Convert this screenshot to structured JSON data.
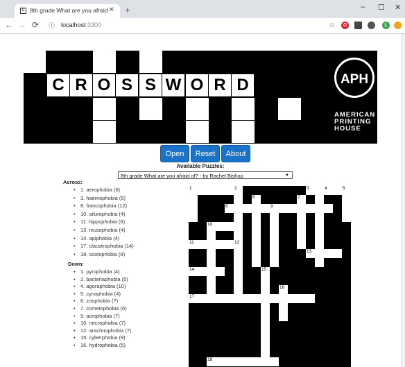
{
  "browser": {
    "tab_title": "8th grade What are you afraid of",
    "url_host": "localhost",
    "url_port": ":3300"
  },
  "banner": {
    "word": [
      "C",
      "R",
      "O",
      "S",
      "S",
      "W",
      "O",
      "R",
      "D"
    ],
    "org_lines": [
      "AMERICAN",
      "PRINTING",
      "HOUSE"
    ],
    "logo_text": "APH"
  },
  "buttons": {
    "open": "Open",
    "reset": "Reset",
    "about": "About"
  },
  "puzzles": {
    "label": "Available Puzzles:",
    "selected": "8th grade What are you afraid of? - by Rachel Bishop"
  },
  "across": {
    "heading": "Across:",
    "clues": [
      "1. aerophobia (6)",
      "3. haemophobia (5)",
      "8. francophobia (12)",
      "10. ailurophobia (4)",
      "11. hippophobia (6)",
      "13. musophobia (4)",
      "14. apiphobia (4)",
      "17. claustrophobia (14)",
      "18. scotophobia (8)"
    ]
  },
  "down": {
    "heading": "Down:",
    "clues": [
      "1. pyrophobia (4)",
      "2. bacteriaphobia (5)",
      "4. agoraphobia (10)",
      "5. cynophobia (4)",
      "6. zoophobia (7)",
      "7. cometophobia (6)",
      "9. acrophobia (7)",
      "10. necrophobia (7)",
      "12. arachnophobia (7)",
      "15. cyberphobia (9)",
      "16. hydrophobia (5)"
    ]
  },
  "grid": {
    "columns": 18,
    "rows": 20,
    "white_cells": [
      [
        0,
        0
      ],
      [
        1,
        0
      ],
      [
        2,
        0
      ],
      [
        3,
        0
      ],
      [
        4,
        0
      ],
      [
        5,
        0
      ],
      [
        13,
        0
      ],
      [
        14,
        0
      ],
      [
        15,
        0
      ],
      [
        16,
        0
      ],
      [
        17,
        0
      ],
      [
        0,
        1
      ],
      [
        5,
        1
      ],
      [
        7,
        1
      ],
      [
        12,
        1
      ],
      [
        14,
        1
      ],
      [
        17,
        1
      ],
      [
        0,
        2
      ],
      [
        4,
        2
      ],
      [
        5,
        2
      ],
      [
        6,
        2
      ],
      [
        7,
        2
      ],
      [
        8,
        2
      ],
      [
        9,
        2
      ],
      [
        10,
        2
      ],
      [
        11,
        2
      ],
      [
        12,
        2
      ],
      [
        13,
        2
      ],
      [
        14,
        2
      ],
      [
        15,
        2
      ],
      [
        17,
        2
      ],
      [
        0,
        3
      ],
      [
        5,
        3
      ],
      [
        7,
        3
      ],
      [
        9,
        3
      ],
      [
        12,
        3
      ],
      [
        14,
        3
      ],
      [
        17,
        3
      ],
      [
        2,
        4
      ],
      [
        3,
        4
      ],
      [
        4,
        4
      ],
      [
        5,
        4
      ],
      [
        7,
        4
      ],
      [
        9,
        4
      ],
      [
        12,
        4
      ],
      [
        14,
        4
      ],
      [
        2,
        5
      ],
      [
        5,
        5
      ],
      [
        7,
        5
      ],
      [
        9,
        5
      ],
      [
        12,
        5
      ],
      [
        14,
        5
      ],
      [
        0,
        6
      ],
      [
        1,
        6
      ],
      [
        2,
        6
      ],
      [
        3,
        6
      ],
      [
        4,
        6
      ],
      [
        5,
        6
      ],
      [
        7,
        6
      ],
      [
        9,
        6
      ],
      [
        12,
        6
      ],
      [
        14,
        6
      ],
      [
        2,
        7
      ],
      [
        5,
        7
      ],
      [
        7,
        7
      ],
      [
        9,
        7
      ],
      [
        13,
        7
      ],
      [
        14,
        7
      ],
      [
        15,
        7
      ],
      [
        16,
        7
      ],
      [
        2,
        8
      ],
      [
        5,
        8
      ],
      [
        7,
        8
      ],
      [
        9,
        8
      ],
      [
        14,
        8
      ],
      [
        0,
        9
      ],
      [
        1,
        9
      ],
      [
        2,
        9
      ],
      [
        3,
        9
      ],
      [
        5,
        9
      ],
      [
        8,
        9
      ],
      [
        2,
        10
      ],
      [
        5,
        10
      ],
      [
        8,
        10
      ],
      [
        2,
        11
      ],
      [
        5,
        11
      ],
      [
        8,
        11
      ],
      [
        10,
        11
      ],
      [
        0,
        12
      ],
      [
        1,
        12
      ],
      [
        2,
        12
      ],
      [
        3,
        12
      ],
      [
        4,
        12
      ],
      [
        5,
        12
      ],
      [
        6,
        12
      ],
      [
        7,
        12
      ],
      [
        8,
        12
      ],
      [
        9,
        12
      ],
      [
        10,
        12
      ],
      [
        11,
        12
      ],
      [
        12,
        12
      ],
      [
        13,
        12
      ],
      [
        8,
        13
      ],
      [
        10,
        13
      ],
      [
        8,
        14
      ],
      [
        10,
        14
      ],
      [
        8,
        15
      ],
      [
        8,
        16
      ],
      [
        8,
        17
      ],
      [
        8,
        18
      ],
      [
        2,
        19
      ],
      [
        3,
        19
      ],
      [
        4,
        19
      ],
      [
        5,
        19
      ],
      [
        6,
        19
      ],
      [
        7,
        19
      ],
      [
        8,
        19
      ],
      [
        9,
        19
      ]
    ],
    "numbers": [
      {
        "n": "1",
        "c": 0,
        "r": 0
      },
      {
        "n": "2",
        "c": 5,
        "r": 0
      },
      {
        "n": "3",
        "c": 13,
        "r": 0
      },
      {
        "n": "4",
        "c": 15,
        "r": 0
      },
      {
        "n": "5",
        "c": 17,
        "r": 0
      },
      {
        "n": "6",
        "c": 7,
        "r": 1
      },
      {
        "n": "7",
        "c": 12,
        "r": 1
      },
      {
        "n": "8",
        "c": 4,
        "r": 2
      },
      {
        "n": "9",
        "c": 9,
        "r": 2
      },
      {
        "n": "10",
        "c": 2,
        "r": 4
      },
      {
        "n": "11",
        "c": 0,
        "r": 6
      },
      {
        "n": "12",
        "c": 5,
        "r": 6
      },
      {
        "n": "13",
        "c": 13,
        "r": 7
      },
      {
        "n": "14",
        "c": 0,
        "r": 9
      },
      {
        "n": "15",
        "c": 8,
        "r": 9
      },
      {
        "n": "16",
        "c": 10,
        "r": 11
      },
      {
        "n": "17",
        "c": 0,
        "r": 12
      },
      {
        "n": "18",
        "c": 2,
        "r": 19
      }
    ]
  }
}
